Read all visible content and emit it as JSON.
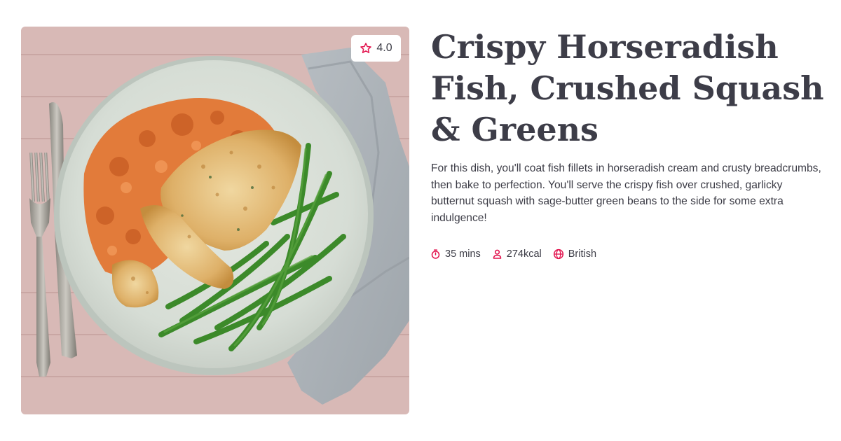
{
  "recipe": {
    "title": "Crispy Horseradish Fish, Crushed Squash & Greens",
    "description": "For this dish, you'll coat fish fillets in horseradish cream and crusty breadcrumbs, then bake to perfection. You'll serve the crispy fish over crushed, garlicky butternut squash with sage-butter green beans to the side for some extra indulgence!",
    "rating": "4.0",
    "meta": {
      "time": "35 mins",
      "calories": "274kcal",
      "cuisine": "British"
    },
    "icons": {
      "rating": "star-outline-icon",
      "time": "stopwatch-icon",
      "calories": "person-icon",
      "cuisine": "globe-icon"
    },
    "colors": {
      "accent": "#e2114c",
      "text": "#3c3c46",
      "title": "#3d3d48",
      "background": "#ffffff"
    }
  }
}
